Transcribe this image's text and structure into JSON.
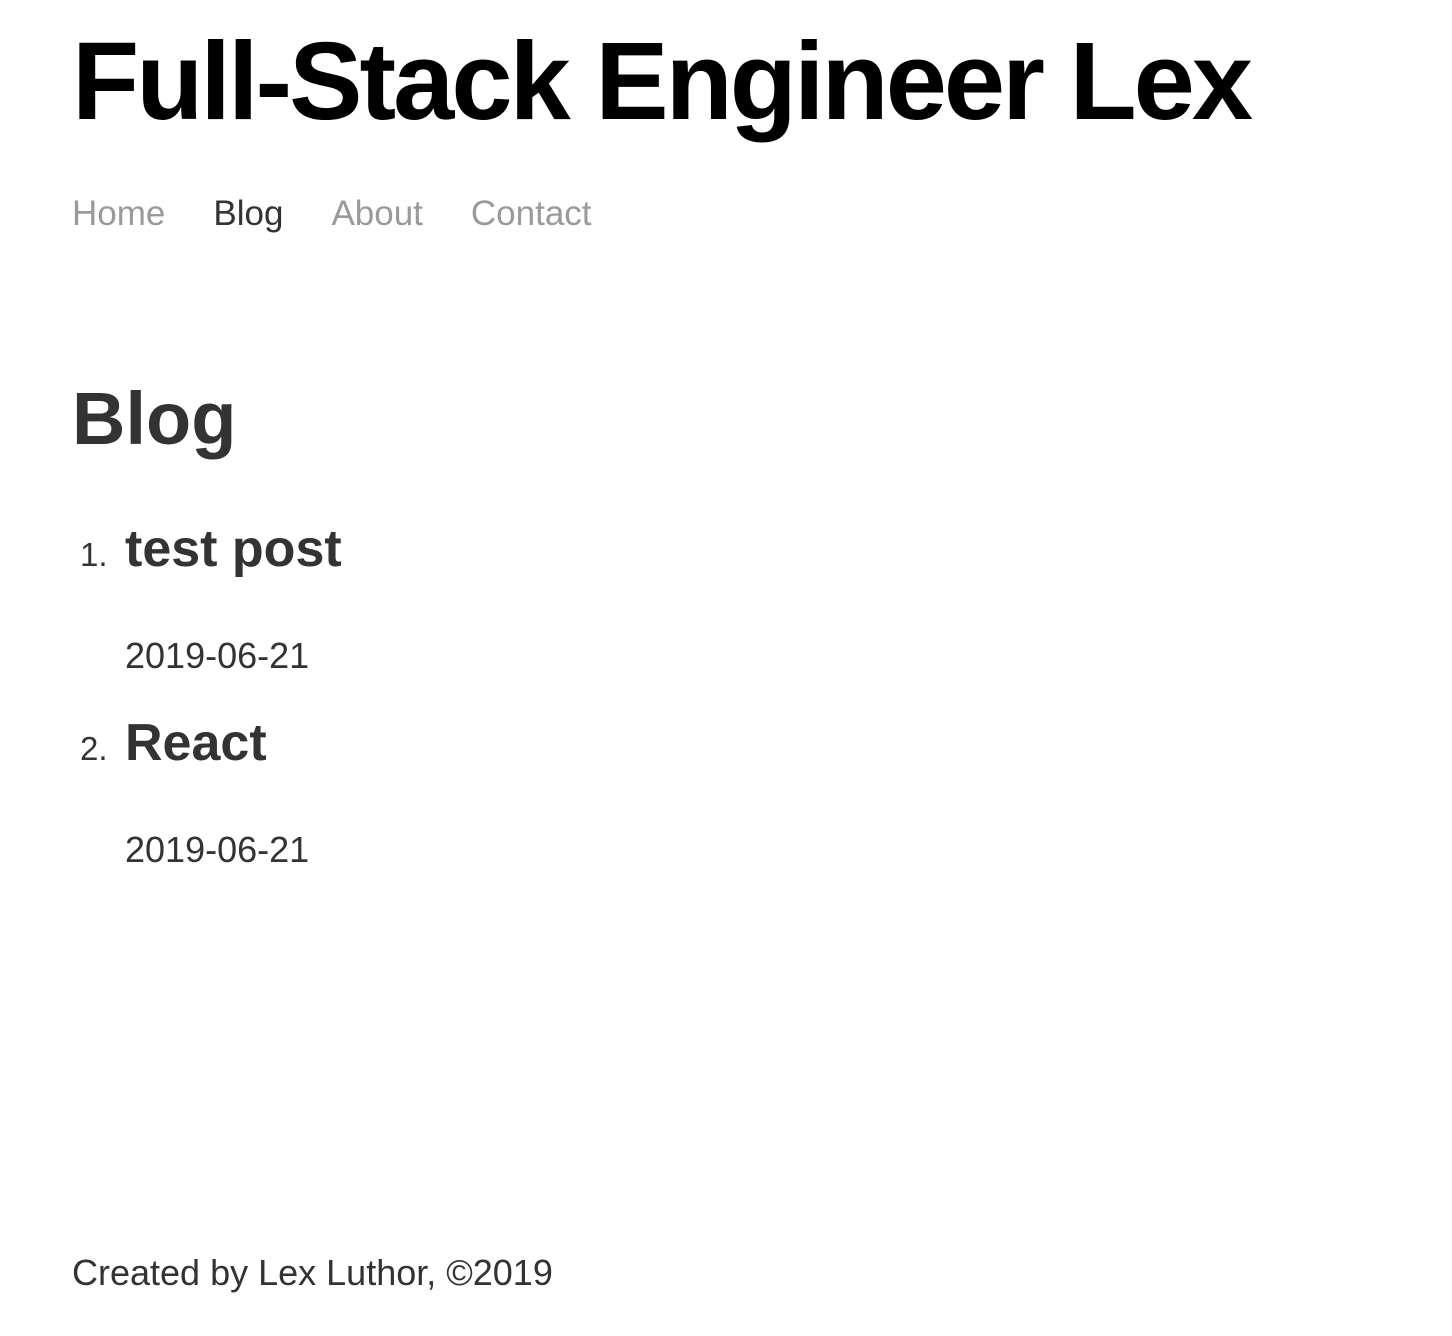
{
  "header": {
    "site_title": "Full-Stack Engineer Lex"
  },
  "nav": {
    "items": [
      {
        "label": "Home",
        "active": false
      },
      {
        "label": "Blog",
        "active": true
      },
      {
        "label": "About",
        "active": false
      },
      {
        "label": "Contact",
        "active": false
      }
    ]
  },
  "main": {
    "heading": "Blog",
    "posts": [
      {
        "number": "1.",
        "title": "test post",
        "date": "2019-06-21"
      },
      {
        "number": "2.",
        "title": "React",
        "date": "2019-06-21"
      }
    ]
  },
  "footer": {
    "text": "Created by Lex Luthor, ©2019"
  },
  "colors": {
    "title": "#000000",
    "text": "#333333",
    "nav_inactive": "#9a9a9a",
    "nav_active": "#333333",
    "background": "#ffffff"
  }
}
